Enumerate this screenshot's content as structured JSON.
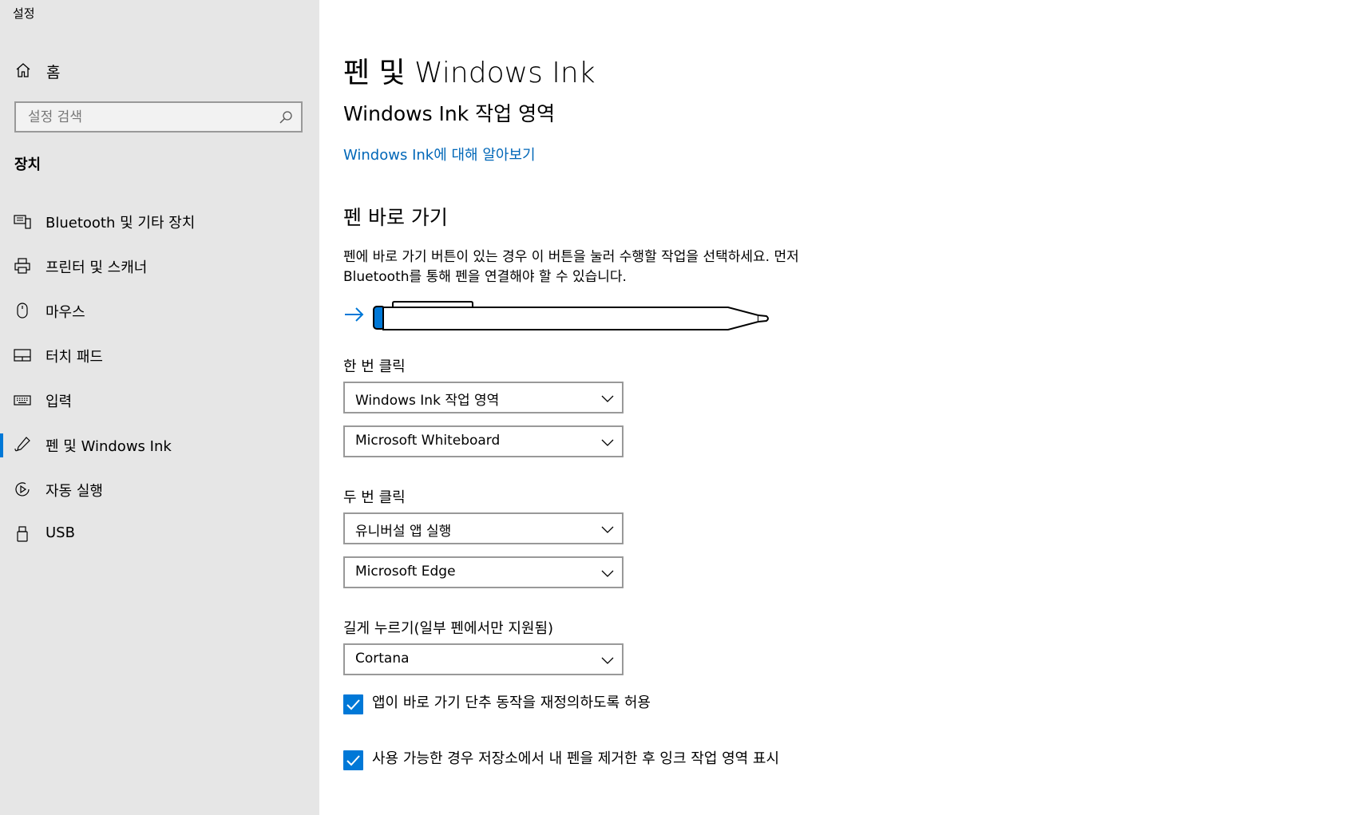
{
  "window": {
    "title": "설정"
  },
  "sidebar": {
    "home_label": "홈",
    "search": {
      "placeholder": "설정 검색",
      "value": ""
    },
    "section_heading": "장치",
    "items": [
      {
        "label": "Bluetooth 및 기타 장치",
        "icon": "bluetooth-device-icon"
      },
      {
        "label": "프린터 및 스캐너",
        "icon": "printer-icon"
      },
      {
        "label": "마우스",
        "icon": "mouse-icon"
      },
      {
        "label": "터치 패드",
        "icon": "touchpad-icon"
      },
      {
        "label": "입력",
        "icon": "keyboard-icon"
      },
      {
        "label": "펜 및 Windows Ink",
        "icon": "pen-icon",
        "active": true
      },
      {
        "label": "자동 실행",
        "icon": "autoplay-icon"
      },
      {
        "label": "USB",
        "icon": "usb-icon"
      }
    ]
  },
  "main": {
    "page_title": "펜 및 Windows Ink",
    "sub_title": "Windows Ink 작업 영역",
    "learn_link": "Windows Ink에 대해 알아보기",
    "shortcut_title": "펜 바로 가기",
    "shortcut_desc": "펜에 바로 가기 버튼이 있는 경우 이 버튼을 눌러 수행할 작업을 선택하세요. 먼저 Bluetooth를 통해 펜을 연결해야 할 수 있습니다.",
    "single_click": {
      "label": "한 번 클릭",
      "action": "Windows Ink 작업 영역",
      "app": "Microsoft Whiteboard"
    },
    "double_click": {
      "label": "두 번 클릭",
      "action": "유니버설 앱 실행",
      "app": "Microsoft Edge"
    },
    "long_press": {
      "label": "길게 누르기(일부 펜에서만 지원됨)",
      "action": "Cortana"
    },
    "checkboxes": [
      {
        "label": "앱이 바로 가기 단추 동작을 재정의하도록 허용",
        "checked": true
      },
      {
        "label": "사용 가능한 경우 저장소에서 내 펜을 제거한 후 잉크 작업 영역 표시",
        "checked": true
      }
    ]
  },
  "colors": {
    "accent": "#0078d7",
    "link": "#0067b8",
    "sidebar_bg": "#e6e6e6"
  }
}
